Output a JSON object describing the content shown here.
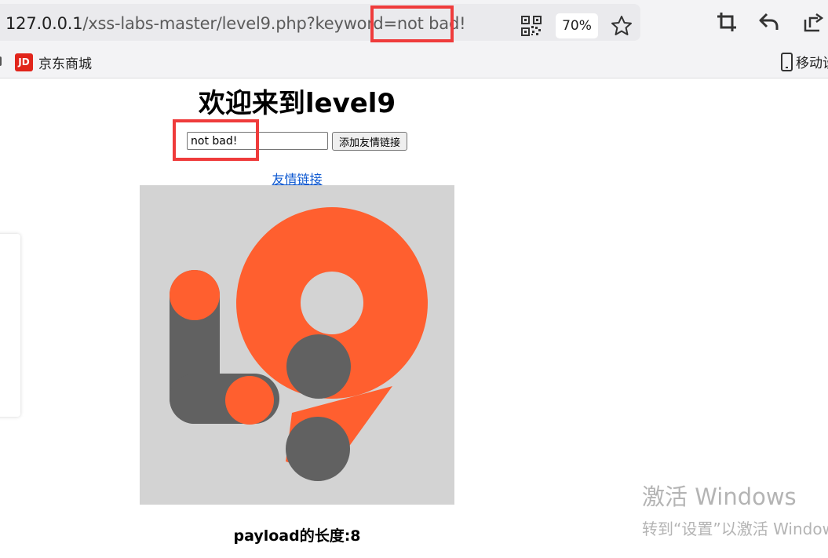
{
  "browser": {
    "url_host": "127.0.0.1",
    "url_path": "/xss-labs-master/level9.php?keyword=not bad!",
    "zoom": "70%",
    "icons": [
      "qr-code-icon",
      "star-icon",
      "crop-icon",
      "undo-icon",
      "share-icon"
    ]
  },
  "bookmarks": {
    "jd_logo": "JD",
    "jd_label": "京东商城",
    "mobile_label": "移动设"
  },
  "page": {
    "title": "欢迎来到level9",
    "keyword_value": "not bad!",
    "add_button_label": "添加友情链接",
    "friend_link_label": "友情链接",
    "payload_text": "payload的长度:8"
  },
  "logo": {
    "background": "#d3d3d3",
    "accent": "#ff5f2f",
    "dark": "#616161"
  },
  "watermark": {
    "line1": "激活 Windows",
    "line2": "转到“设置”以激活 Windows。"
  },
  "colors": {
    "highlight": "#ef3b3b",
    "link": "#0b57d0"
  }
}
